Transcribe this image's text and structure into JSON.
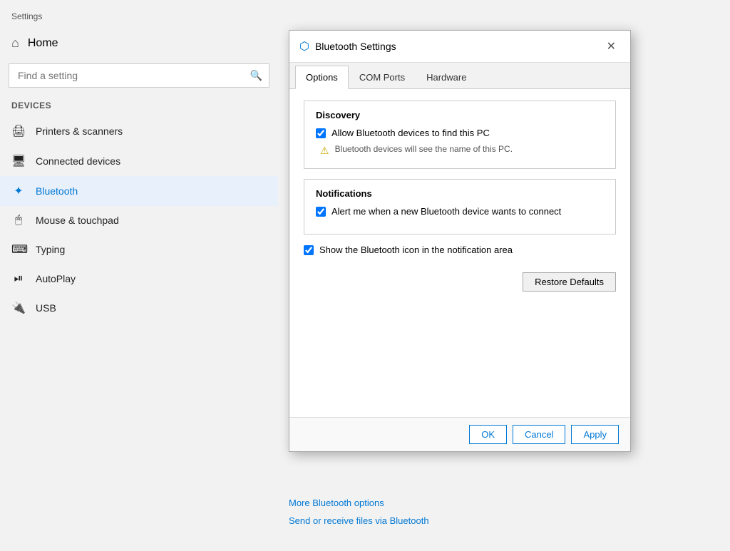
{
  "app": {
    "title": "Settings"
  },
  "sidebar": {
    "home_label": "Home",
    "search_placeholder": "Find a setting",
    "devices_label": "Devices",
    "nav_items": [
      {
        "id": "printers",
        "label": "Printers & scanners",
        "icon": "🖨"
      },
      {
        "id": "connected",
        "label": "Connected devices",
        "icon": "🖥"
      },
      {
        "id": "bluetooth",
        "label": "Bluetooth",
        "icon": "✦",
        "active": true
      },
      {
        "id": "mouse",
        "label": "Mouse & touchpad",
        "icon": "🖱"
      },
      {
        "id": "typing",
        "label": "Typing",
        "icon": "⌨"
      },
      {
        "id": "autoplay",
        "label": "AutoPlay",
        "icon": "⏯"
      },
      {
        "id": "usb",
        "label": "USB",
        "icon": "🔌"
      }
    ]
  },
  "dialog": {
    "title": "Bluetooth Settings",
    "close_label": "✕",
    "tabs": [
      {
        "id": "options",
        "label": "Options",
        "active": true
      },
      {
        "id": "comports",
        "label": "COM Ports"
      },
      {
        "id": "hardware",
        "label": "Hardware"
      }
    ],
    "discovery": {
      "section_label": "Discovery",
      "allow_label": "Allow Bluetooth devices to find this PC",
      "allow_checked": true,
      "warning_text": "Bluetooth devices will see the name of this PC."
    },
    "notifications": {
      "section_label": "Notifications",
      "alert_label": "Alert me when a new Bluetooth device wants to connect",
      "alert_checked": true,
      "show_icon_label": "Show the Bluetooth icon in the notification area",
      "show_icon_checked": true
    },
    "restore_defaults_label": "Restore Defaults",
    "ok_label": "OK",
    "cancel_label": "Cancel",
    "apply_label": "Apply"
  },
  "bottom_links": [
    {
      "label": "More Bluetooth options"
    },
    {
      "label": "Send or receive files via Bluetooth"
    }
  ]
}
